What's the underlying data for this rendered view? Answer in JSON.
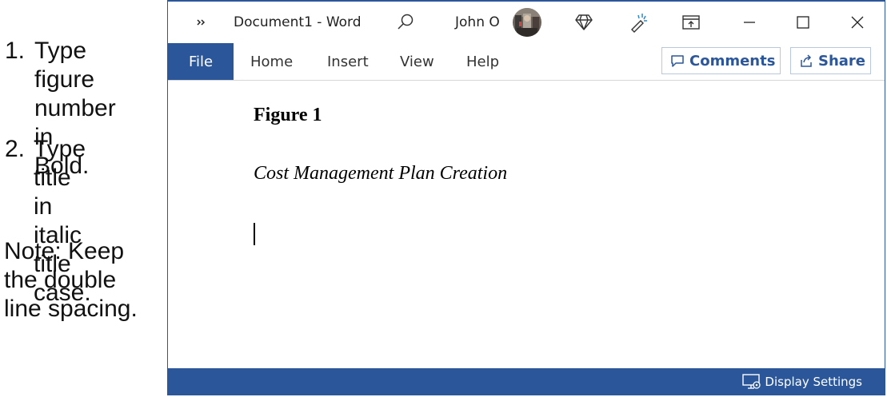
{
  "instructions": {
    "step1": {
      "number": "1.",
      "line1": "Type figure",
      "line2": "number in",
      "line3": "Bold."
    },
    "step2": {
      "number": "2.",
      "line1": "Type title in",
      "line2": "italic title",
      "line3": "case."
    },
    "note": {
      "line1": "Note: Keep",
      "line2": "the double",
      "line3": "line spacing."
    }
  },
  "titlebar": {
    "document_title": "Document1  -  Word",
    "user_name": "John O"
  },
  "ribbon": {
    "tabs": [
      "File",
      "Home",
      "Insert",
      "View",
      "Help"
    ],
    "comments_label": "Comments",
    "share_label": "Share"
  },
  "document": {
    "figure_number": "Figure 1",
    "figure_title": "Cost Management Plan Creation"
  },
  "statusbar": {
    "display_settings_label": "Display Settings"
  },
  "colors": {
    "accent": "#2b579a"
  }
}
